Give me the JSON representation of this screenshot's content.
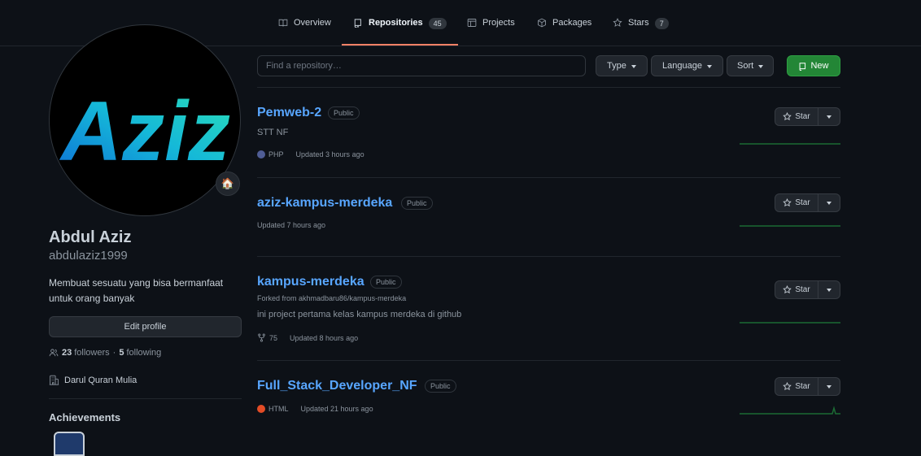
{
  "nav": {
    "tabs": [
      {
        "label": "Overview",
        "icon": "book-icon"
      },
      {
        "label": "Repositories",
        "icon": "repo-icon",
        "count": "45"
      },
      {
        "label": "Projects",
        "icon": "table-icon"
      },
      {
        "label": "Packages",
        "icon": "package-icon"
      },
      {
        "label": "Stars",
        "icon": "star-icon",
        "count": "7"
      }
    ],
    "active_tab": "Repositories"
  },
  "profile": {
    "avatar_text": "Aziz",
    "status_emoji": "🏠",
    "fullname": "Abdul Aziz",
    "login": "abdulaziz1999",
    "bio": "Membuat sesuatu yang bisa bermanfaat untuk orang banyak",
    "edit_label": "Edit profile",
    "followers_count": "23",
    "followers_label": "followers",
    "separator": "·",
    "following_count": "5",
    "following_label": "following",
    "organization": "Darul Quran Mulia",
    "achievements_title": "Achievements"
  },
  "toolbar": {
    "search_placeholder": "Find a repository…",
    "type_label": "Type",
    "language_label": "Language",
    "sort_label": "Sort",
    "new_label": "New"
  },
  "repos": [
    {
      "name": "Pemweb-2",
      "visibility": "Public",
      "description": "STT NF",
      "language": "PHP",
      "language_color": "#4F5D95",
      "updated": "Updated 3 hours ago"
    },
    {
      "name": "aziz-kampus-merdeka",
      "visibility": "Public",
      "updated": "Updated 7 hours ago"
    },
    {
      "name": "kampus-merdeka",
      "visibility": "Public",
      "forked_from": "Forked from akhmadbaru86/kampus-merdeka",
      "description": "ini project pertama kelas kampus merdeka di github",
      "forks": "75",
      "updated": "Updated 8 hours ago"
    },
    {
      "name": "Full_Stack_Developer_NF",
      "visibility": "Public",
      "language": "HTML",
      "language_color": "#e34c26",
      "updated": "Updated 21 hours ago"
    }
  ],
  "star_label": "Star",
  "colors": {
    "accent_link": "#58a6ff",
    "primary_button": "#238636",
    "active_tab_underline": "#f78166",
    "sparkline": "#1b6b34"
  }
}
